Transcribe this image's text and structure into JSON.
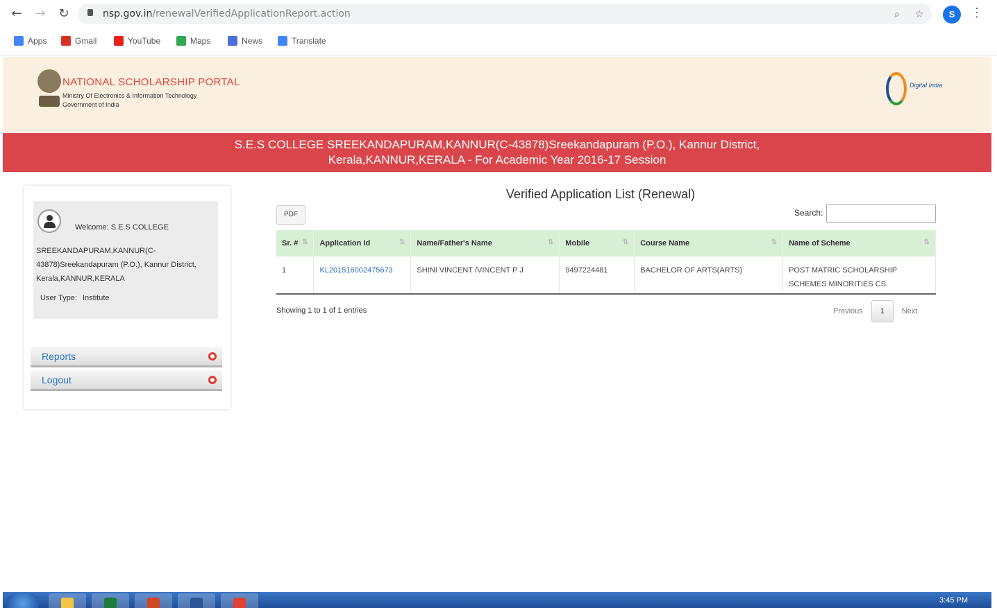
{
  "browser": {
    "url_host": "nsp.gov.in",
    "url_path": "/renewalVerifiedApplicationReport.action",
    "profile_initial": "S",
    "bookmarks": [
      {
        "label": "Apps",
        "color": "#4285f4"
      },
      {
        "label": "Gmail",
        "color": "#d93025"
      },
      {
        "label": "YouTube",
        "color": "#e62117"
      },
      {
        "label": "Maps",
        "color": "#34a853"
      },
      {
        "label": "News",
        "color": "#4b6fd6"
      },
      {
        "label": "Translate",
        "color": "#4285f4"
      }
    ]
  },
  "header": {
    "portal_title": "NATIONAL SCHOLARSHIP PORTAL",
    "ministry": "Ministry Of Electronics & Information Technology",
    "government": "Government of India",
    "digital_india": "Digital India"
  },
  "banner": {
    "line1": "S.E.S COLLEGE SREEKANDAPURAM,KANNUR(C-43878)Sreekandapuram (P.O.), Kannur District,",
    "line2": "Kerala,KANNUR,KERALA - For Academic Year 2016-17 Session"
  },
  "sidebar": {
    "welcome": "Welcome: S.E.S COLLEGE",
    "institute": "SREEKANDAPURAM,KANNUR(C-43878)Sreekandapuram (P.O.), Kannur District, Kerala,KANNUR,KERALA",
    "user_type_label": "User Type:",
    "user_type_value": "Institute",
    "menu": [
      {
        "label": "Reports"
      },
      {
        "label": "Logout"
      }
    ]
  },
  "main": {
    "title": "Verified Application List (Renewal)",
    "pdf_label": "PDF",
    "search_label": "Search:",
    "search_value": "",
    "columns": [
      "Sr. #",
      "Application Id",
      "Name/Father's Name",
      "Mobile",
      "Course Name",
      "Name of Scheme"
    ],
    "rows": [
      {
        "sr": "1",
        "app_id": "KL201516002475673",
        "name": "SHINI VINCENT /VINCENT P J",
        "mobile": "9497224481",
        "course": "BACHELOR OF ARTS(ARTS)",
        "scheme": "POST MATRIC SCHOLARSHIP SCHEMES MINORITIES CS"
      }
    ],
    "showing": "Showing 1 to 1 of 1 entries",
    "pager": {
      "previous": "Previous",
      "page": "1",
      "next": "Next"
    }
  },
  "taskbar": {
    "time": "3:45 PM",
    "apps": [
      {
        "name": "explorer",
        "color": "#f4c542"
      },
      {
        "name": "excel",
        "color": "#1e7b3a"
      },
      {
        "name": "powerpoint",
        "color": "#d24726"
      },
      {
        "name": "word",
        "color": "#2b5797"
      },
      {
        "name": "chrome",
        "color": "#e34133"
      }
    ]
  }
}
